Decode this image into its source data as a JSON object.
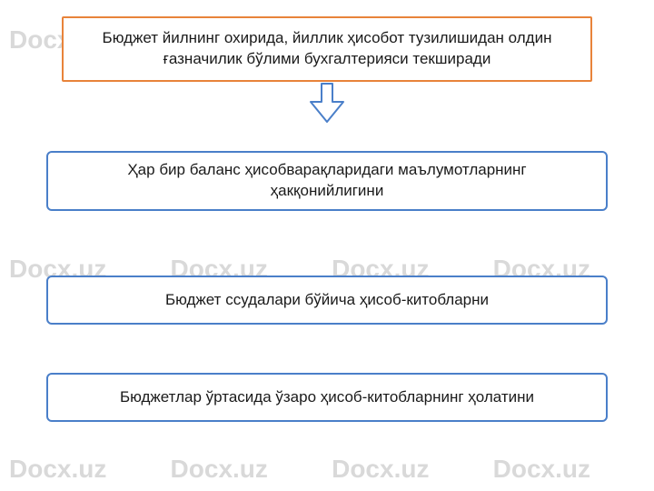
{
  "watermark": "Docx.uz",
  "header": {
    "text": "Бюджет йилнинг охирида, йиллик ҳисобот тузилишидан олдин ғазначилик бўлими бухгалтерияси текширади"
  },
  "items": [
    {
      "text": "Ҳар бир баланс ҳисобварақларидаги маълумотларнинг ҳакқонийлигини"
    },
    {
      "text": "Бюджет ссудалари бўйича ҳисоб-китобларни"
    },
    {
      "text": "Бюджетлар ўртасида ўзаро ҳисоб-китобларнинг ҳолатини"
    }
  ],
  "colors": {
    "header_border": "#e8833a",
    "item_border": "#4a7fc9",
    "arrow_stroke": "#4a7fc9",
    "watermark": "#d9d9d9"
  }
}
